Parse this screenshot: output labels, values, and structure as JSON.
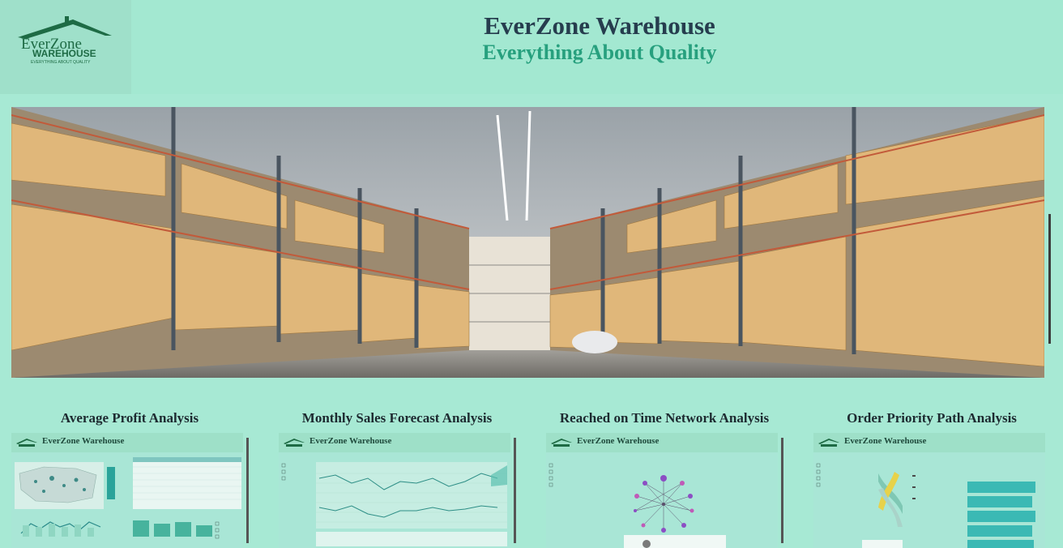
{
  "header": {
    "title": "EverZone Warehouse",
    "subtitle": "Everything About Quality",
    "logo_text_top": "EverZone",
    "logo_text_bottom": "WAREHOUSE",
    "logo_tagline": "EVERYTHING ABOUT QUALITY"
  },
  "hero": {
    "image": "warehouse-aisle-photo"
  },
  "cards": [
    {
      "title": "Average Profit Analysis",
      "thumb_brand": "EverZone Warehouse"
    },
    {
      "title": "Monthly Sales Forecast Analysis",
      "thumb_brand": "EverZone Warehouse"
    },
    {
      "title": "Reached on Time Network Analysis",
      "thumb_brand": "EverZone Warehouse"
    },
    {
      "title": "Order Priority Path Analysis",
      "thumb_brand": "EverZone Warehouse"
    }
  ],
  "colors": {
    "background": "#a7e9d4",
    "title": "#263d4e",
    "subtitle": "#27a07e",
    "brand_green": "#1e6b45"
  }
}
